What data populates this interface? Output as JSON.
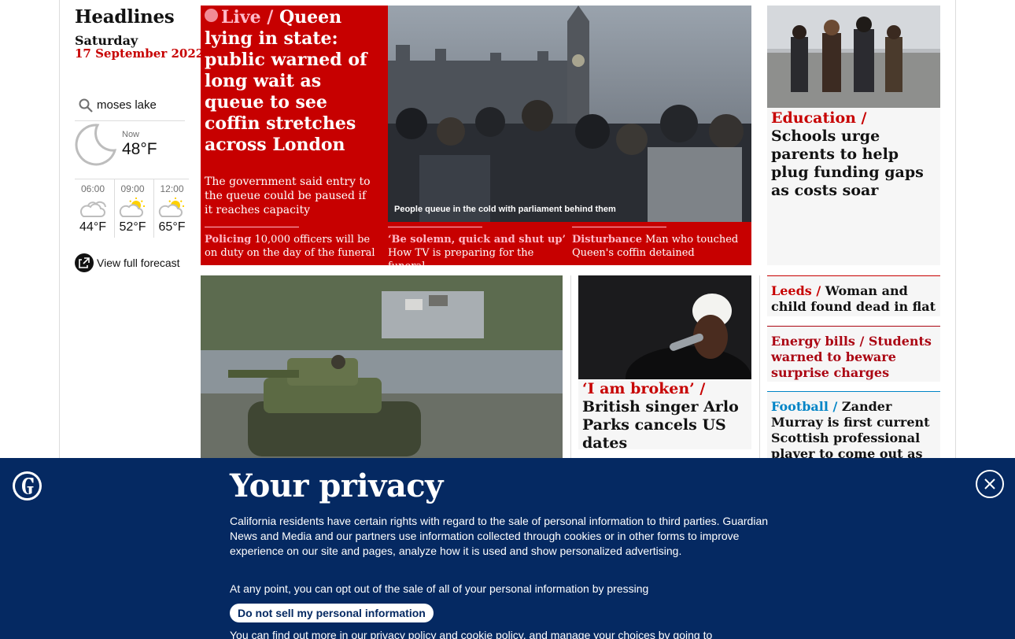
{
  "sidebar": {
    "title": "Headlines",
    "day": "Saturday",
    "date": "17 September 2022",
    "search_value": "moses lake",
    "weather": {
      "now_label": "Now",
      "now_temp": "48°F",
      "now_icon": "moon-icon",
      "forecast": [
        {
          "time": "06:00",
          "temp": "44°F",
          "icon": "cloud-icon"
        },
        {
          "time": "09:00",
          "temp": "52°F",
          "icon": "sun-cloud-icon"
        },
        {
          "time": "12:00",
          "temp": "65°F",
          "icon": "sun-cloud-icon"
        }
      ],
      "full_forecast_label": "View full forecast"
    }
  },
  "lead": {
    "kicker": "Live /",
    "headline": "Queen lying in state: public warned of long wait as queue to see coffin stretches across London",
    "standfirst": "The government said entry to the queue could be paused if it reaches capacity",
    "image_caption": "People queue in the cold with parliament behind them",
    "sublinks": [
      {
        "kicker": "Policing",
        "text": " 10,000 officers will be on duty on the day of the funeral"
      },
      {
        "kicker": "‘Be solemn, quick and shut up’",
        "text": " How TV is preparing for the funeral"
      },
      {
        "kicker": "Disturbance",
        "text": " Man who touched Queen's coffin detained"
      }
    ]
  },
  "education": {
    "kicker": "Education /",
    "headline": "Schools urge parents to help plug funding gaps as costs soar"
  },
  "small_stories": [
    {
      "kicker": "Leeds /",
      "headline": "Woman and child found dead in flat",
      "color": "#c70000"
    },
    {
      "kicker": "Energy bills /",
      "headline": "Students warned to beware surprise charges",
      "color": "#ab0613"
    },
    {
      "kicker": "Football /",
      "headline": "Zander Murray is first current Scottish professional player to come out as gay",
      "color": "#0084c6"
    }
  ],
  "culture": {
    "kicker": "‘I am broken’ /",
    "headline": "British singer Arlo Parks cancels US dates",
    "color": "#c70000"
  },
  "privacy": {
    "title": "Your privacy",
    "body": "California residents have certain rights with regard to the sale of personal information to third parties. Guardian News and Media and our partners use information collected through cookies or in other forms to improve experience on our site and pages, analyze how it is used and show personalized advertising.",
    "optout_text": "At any point, you can opt out of the sale of all of your personal information by pressing",
    "button_label": "Do not sell my personal information",
    "more_text": "You can find out more in our privacy policy and cookie policy, and manage your choices by going to"
  },
  "colors": {
    "news_red": "#c70000",
    "pink": "#ffbac8",
    "banner_blue": "#052962",
    "energy": "#ab0613",
    "sport_blue": "#0084c6"
  }
}
